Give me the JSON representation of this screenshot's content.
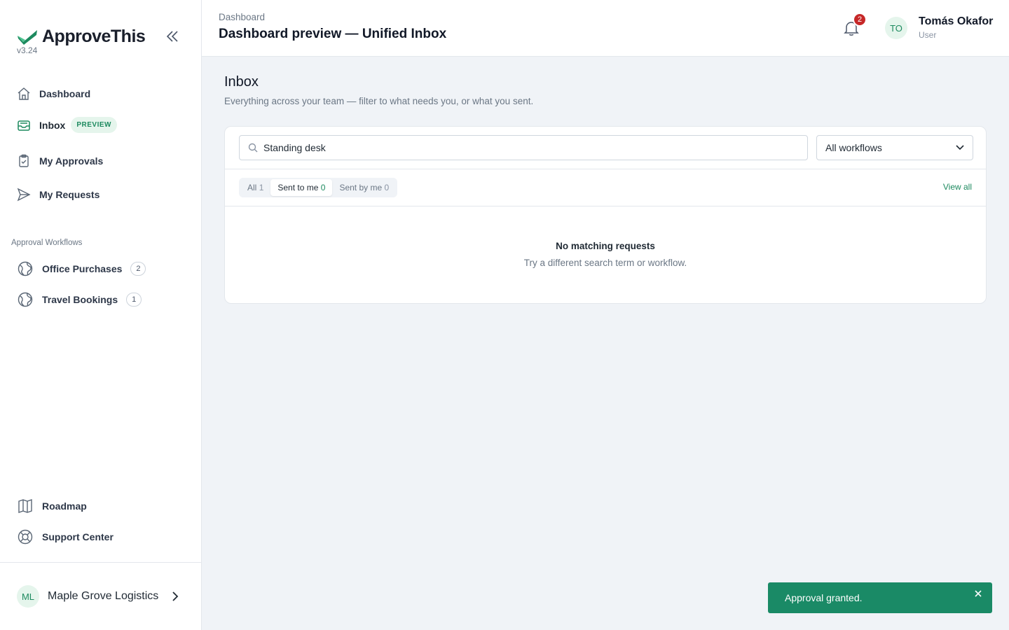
{
  "app": {
    "name": "ApproveThis",
    "version": "v3.24",
    "brand_color": "#1d8a5f"
  },
  "sidebar": {
    "nav": [
      {
        "label": "Dashboard",
        "icon": "home-icon"
      },
      {
        "label": "Inbox",
        "icon": "inbox-icon",
        "badge": "PREVIEW"
      },
      {
        "label": "My Approvals",
        "icon": "clipboard-icon"
      },
      {
        "label": "My Requests",
        "icon": "send-icon"
      }
    ],
    "workflows_label": "Approval Workflows",
    "workflows": [
      {
        "label": "Office Purchases",
        "count": "2",
        "icon": "globe-icon"
      },
      {
        "label": "Travel Bookings",
        "count": "1",
        "icon": "globe-icon"
      }
    ],
    "bottom": [
      {
        "label": "Roadmap",
        "icon": "map-icon"
      },
      {
        "label": "Support Center",
        "icon": "lifebuoy-icon"
      }
    ],
    "org": {
      "initials": "ML",
      "name": "Maple Grove Logistics"
    }
  },
  "header": {
    "breadcrumb": "Dashboard",
    "title": "Dashboard preview — Unified Inbox",
    "notifications": "2",
    "user": {
      "initials": "TO",
      "name": "Tomás Okafor",
      "role": "User"
    }
  },
  "main": {
    "title": "Inbox",
    "subtitle": "Everything across your team — filter to what needs you, or what you sent.",
    "search": {
      "value": "Standing desk"
    },
    "workflow_select": "All workflows",
    "tabs": [
      {
        "label": "All",
        "count": "1",
        "active": false
      },
      {
        "label": "Sent to me",
        "count": "0",
        "active": true
      },
      {
        "label": "Sent by me",
        "count": "0",
        "active": false
      }
    ],
    "view_all": "View all",
    "empty": {
      "title": "No matching requests",
      "subtitle": "Try a different search term or workflow."
    }
  },
  "toast": {
    "message": "Approval granted."
  }
}
